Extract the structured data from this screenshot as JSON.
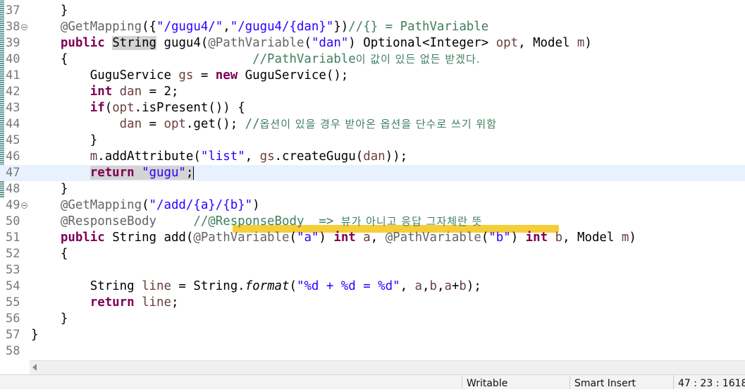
{
  "editor": {
    "current_line": 47,
    "lines": [
      {
        "num": "37",
        "fold": false,
        "segments": [
          [
            "",
            "    }"
          ]
        ]
      },
      {
        "num": "38",
        "fold": true,
        "segments": [
          [
            "ann",
            "    @GetMapping"
          ],
          [
            "",
            "({"
          ],
          [
            "str",
            "\"/gugu4/\""
          ],
          [
            "",
            ","
          ],
          [
            "str",
            "\"/gugu4/{dan}\""
          ],
          [
            "",
            "})"
          ],
          [
            "cm",
            "//{} = PathVariable"
          ]
        ]
      },
      {
        "num": "39",
        "fold": false,
        "segments": [
          [
            "",
            "    "
          ],
          [
            "kw",
            "public"
          ],
          [
            "",
            " "
          ],
          [
            "occ",
            "String"
          ],
          [
            "",
            " gugu4("
          ],
          [
            "ann",
            "@PathVariable"
          ],
          [
            "",
            "("
          ],
          [
            "str",
            "\"dan\""
          ],
          [
            "",
            ") Optional<Integer> "
          ],
          [
            "var",
            "opt"
          ],
          [
            "",
            ", Model "
          ],
          [
            "var",
            "m"
          ],
          [
            "",
            ")"
          ]
        ]
      },
      {
        "num": "40",
        "fold": false,
        "segments": [
          [
            "",
            "    {                         "
          ],
          [
            "cm",
            "//PathVariable"
          ],
          [
            "cmk",
            "이 값이 있든 없든 받겠다."
          ]
        ]
      },
      {
        "num": "41",
        "fold": false,
        "segments": [
          [
            "",
            "        GuguService "
          ],
          [
            "var",
            "gs"
          ],
          [
            "",
            " = "
          ],
          [
            "kw",
            "new"
          ],
          [
            "",
            " GuguService();"
          ]
        ]
      },
      {
        "num": "42",
        "fold": false,
        "segments": [
          [
            "",
            "        "
          ],
          [
            "kw",
            "int"
          ],
          [
            "",
            " "
          ],
          [
            "var",
            "dan"
          ],
          [
            "",
            " = 2;"
          ]
        ]
      },
      {
        "num": "43",
        "fold": false,
        "segments": [
          [
            "",
            "        "
          ],
          [
            "kw",
            "if"
          ],
          [
            "",
            "("
          ],
          [
            "var",
            "opt"
          ],
          [
            "",
            ".isPresent()) {"
          ]
        ]
      },
      {
        "num": "44",
        "fold": false,
        "segments": [
          [
            "",
            "            "
          ],
          [
            "var",
            "dan"
          ],
          [
            "",
            " = "
          ],
          [
            "var",
            "opt"
          ],
          [
            "",
            ".get(); "
          ],
          [
            "cm",
            "//"
          ],
          [
            "cmk",
            "옵션이 있을 경우 받아온 옵션을 단수로 쓰기 위함"
          ]
        ]
      },
      {
        "num": "45",
        "fold": false,
        "segments": [
          [
            "",
            "        }"
          ]
        ]
      },
      {
        "num": "46",
        "fold": false,
        "segments": [
          [
            "",
            "        "
          ],
          [
            "var",
            "m"
          ],
          [
            "",
            ".addAttribute("
          ],
          [
            "str",
            "\"list\""
          ],
          [
            "",
            ", "
          ],
          [
            "var",
            "gs"
          ],
          [
            "",
            ".createGugu("
          ],
          [
            "var",
            "dan"
          ],
          [
            "",
            "));"
          ]
        ]
      },
      {
        "num": "47",
        "fold": false,
        "segments": [
          [
            "",
            "        "
          ],
          [
            "kwhl",
            "return"
          ],
          [
            "rethl",
            " "
          ],
          [
            "strhl",
            "\"gugu\""
          ],
          [
            "rethl",
            ";"
          ],
          [
            "caret",
            ""
          ]
        ]
      },
      {
        "num": "48",
        "fold": false,
        "segments": [
          [
            "",
            "    }"
          ]
        ]
      },
      {
        "num": "49",
        "fold": true,
        "segments": [
          [
            "ann",
            "    @GetMapping"
          ],
          [
            "",
            "("
          ],
          [
            "str",
            "\"/add/{a}/{b}\""
          ],
          [
            "",
            ")"
          ]
        ]
      },
      {
        "num": "50",
        "fold": false,
        "segments": [
          [
            "ann",
            "    @ResponseBody"
          ],
          [
            "",
            "     "
          ],
          [
            "cm",
            "//@ResponseBody  => "
          ],
          [
            "cmk",
            "뷰가 아니고 응답 그자체란 뜻"
          ]
        ]
      },
      {
        "num": "51",
        "fold": false,
        "segments": [
          [
            "",
            "    "
          ],
          [
            "kw",
            "public"
          ],
          [
            "",
            " String add("
          ],
          [
            "ann",
            "@PathVariable"
          ],
          [
            "",
            "("
          ],
          [
            "str",
            "\"a\""
          ],
          [
            "",
            ") "
          ],
          [
            "kw",
            "int"
          ],
          [
            "",
            " "
          ],
          [
            "var",
            "a"
          ],
          [
            "",
            ", "
          ],
          [
            "ann",
            "@PathVariable"
          ],
          [
            "",
            "("
          ],
          [
            "str",
            "\"b\""
          ],
          [
            "",
            ") "
          ],
          [
            "kw",
            "int"
          ],
          [
            "",
            " "
          ],
          [
            "var",
            "b"
          ],
          [
            "",
            ", Model "
          ],
          [
            "var",
            "m"
          ],
          [
            "",
            ")"
          ]
        ]
      },
      {
        "num": "52",
        "fold": false,
        "segments": [
          [
            "",
            "    {"
          ]
        ]
      },
      {
        "num": "53",
        "fold": false,
        "segments": [
          [
            "",
            ""
          ]
        ]
      },
      {
        "num": "54",
        "fold": false,
        "segments": [
          [
            "",
            "        String "
          ],
          [
            "var",
            "line"
          ],
          [
            "",
            " = String."
          ],
          [
            "it",
            "format"
          ],
          [
            "",
            "("
          ],
          [
            "str",
            "\"%d + %d = %d\""
          ],
          [
            "",
            ", "
          ],
          [
            "var",
            "a"
          ],
          [
            "",
            ","
          ],
          [
            "var",
            "b"
          ],
          [
            "",
            ","
          ],
          [
            "var",
            "a"
          ],
          [
            "",
            "+"
          ],
          [
            "var",
            "b"
          ],
          [
            "",
            ");"
          ]
        ]
      },
      {
        "num": "55",
        "fold": false,
        "segments": [
          [
            "",
            "        "
          ],
          [
            "kw",
            "return"
          ],
          [
            "",
            " "
          ],
          [
            "var",
            "line"
          ],
          [
            "",
            ";"
          ]
        ]
      },
      {
        "num": "56",
        "fold": false,
        "segments": [
          [
            "",
            "    }"
          ]
        ]
      },
      {
        "num": "57",
        "fold": false,
        "segments": [
          [
            "",
            "}"
          ]
        ]
      },
      {
        "num": "58",
        "fold": false,
        "segments": [
          [
            "",
            ""
          ]
        ]
      }
    ]
  },
  "statusbar": {
    "writable": "Writable",
    "insert_mode": "Smart Insert",
    "position": "47 : 23 : 1618"
  }
}
